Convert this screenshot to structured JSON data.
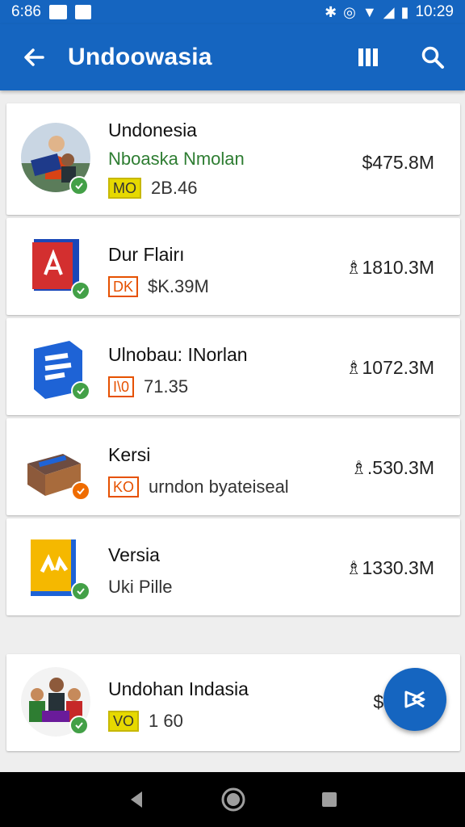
{
  "status_bar": {
    "time_left": "6:86",
    "time_right": "10:29"
  },
  "app_bar": {
    "title": "Undoowasia"
  },
  "items": [
    {
      "name": "Undonesia",
      "subtitle": "Nboaska Nmolan",
      "badge": "MO",
      "badge_style": "yellow",
      "meta": "2B.46",
      "price": "$475.8M",
      "check": "green"
    },
    {
      "name": "Dur Flairı",
      "badge": "DK",
      "badge_style": "orange",
      "meta": "$K.39M",
      "price": "1810.3M",
      "check": "green"
    },
    {
      "name": "Ulnobau: INorlan",
      "badge": "I\\0",
      "badge_style": "orange",
      "meta": "71.35",
      "price": "1072.3M",
      "check": "green"
    },
    {
      "name": "Kersi",
      "badge": "KO",
      "badge_style": "orange",
      "meta": "urndon byateiseal",
      "price": ".530.3M",
      "check": "orange"
    },
    {
      "name": "Versia",
      "meta": "Uki Pille",
      "price": "1330.3M",
      "check": "green"
    },
    {
      "name": "Undohan Indasia",
      "badge": "VO",
      "badge_style": "yellow",
      "meta": "1 60",
      "price": "$5",
      "check": "green"
    }
  ],
  "colors": {
    "primary": "#1565c0",
    "check_green": "#43a047",
    "badge_orange": "#e65100",
    "badge_yellow": "#e6d900",
    "subtitle_green": "#2e7d32"
  },
  "icons": {
    "back": "arrow-left-icon",
    "columns": "columns-icon",
    "search": "search-icon",
    "fab": "play-icon"
  }
}
